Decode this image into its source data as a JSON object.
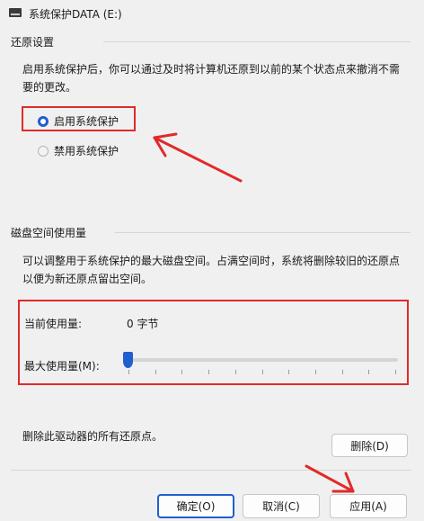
{
  "window": {
    "title": "系统保护DATA (E:)"
  },
  "restore_settings": {
    "heading": "还原设置",
    "description": "启用系统保护后，你可以通过及时将计算机还原到以前的某个状态点来撤消不需要的更改。",
    "options": [
      {
        "label": "启用系统保护",
        "selected": true
      },
      {
        "label": "禁用系统保护",
        "selected": false
      }
    ]
  },
  "disk_usage": {
    "heading": "磁盘空间使用量",
    "description": "可以调整用于系统保护的最大磁盘空间。占满空间时，系统将删除较旧的还原点以便为新还原点留出空间。",
    "current_label": "当前使用量:",
    "current_value": "0 字节",
    "max_label": "最大使用量(M):",
    "slider_value_percent": 0
  },
  "delete_section": {
    "text": "删除此驱动器的所有还原点。",
    "button": "删除(D)"
  },
  "footer": {
    "ok": "确定(O)",
    "cancel": "取消(C)",
    "apply": "应用(A)"
  },
  "colors": {
    "accent": "#1f5fd0",
    "annotation_red": "#e02a2a"
  }
}
